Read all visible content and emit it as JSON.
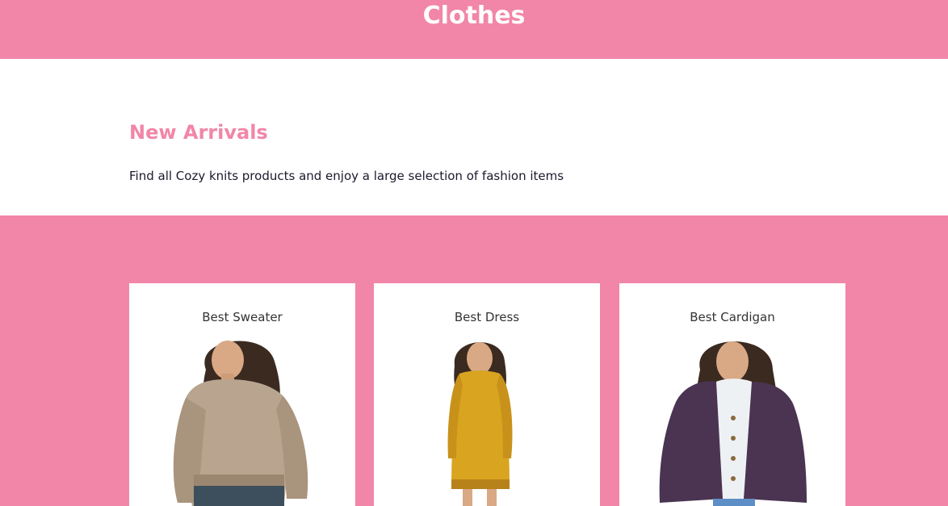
{
  "header": {
    "title": "Clothes",
    "background_color": "#f186a8"
  },
  "intro": {
    "heading": "New Arrivals",
    "description": "Find all Cozy knits products and enjoy a large selection of fashion items",
    "heading_color": "#f186a8"
  },
  "products": {
    "background_color": "#f186a8",
    "items": [
      {
        "title": "Best Sweater",
        "image": "woman-beige-sweater-photo"
      },
      {
        "title": "Best Dress",
        "image": "woman-mustard-sweater-dress-photo"
      },
      {
        "title": "Best Cardigan",
        "image": "woman-purple-cardigan-photo"
      }
    ]
  }
}
